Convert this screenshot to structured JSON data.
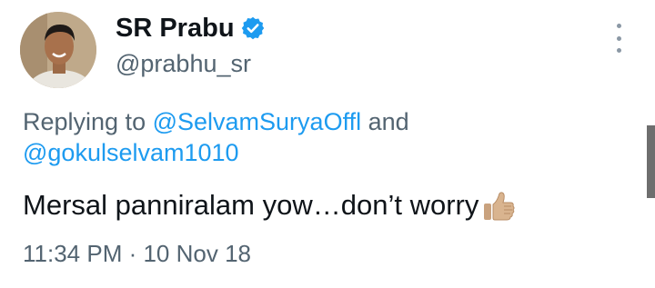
{
  "author": {
    "display_name": "SR Prabu",
    "handle": "@prabhu_sr",
    "verified": true
  },
  "reply": {
    "prefix": "Replying to ",
    "mention1": "@SelvamSuryaOffl",
    "conjunction": " and",
    "mention2": "@gokulselvam1010"
  },
  "tweet": {
    "text": "Mersal panniralam yow…don’t worry",
    "emoji": "thumbs-up-icon"
  },
  "timestamp": "11:34 PM · 10 Nov 18",
  "colors": {
    "text": "#0f1419",
    "secondary": "#536471",
    "link": "#1d9bf0",
    "verified": "#1d9bf0"
  }
}
